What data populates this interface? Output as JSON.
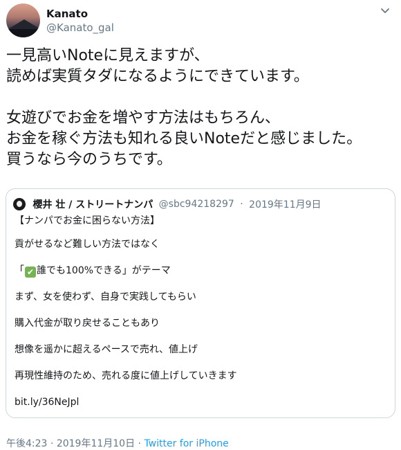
{
  "author": {
    "name": "Kanato",
    "handle": "@Kanato_gal"
  },
  "tweet": {
    "paragraphs": [
      [
        "一見高いNoteに見えますが、",
        "読めば実質タダになるようにできています。"
      ],
      [
        "女遊びでお金を増やす方法はもちろん、",
        "お金を稼ぐ方法も知れる良いNoteだと感じました。",
        "買うなら今のうちです。"
      ]
    ]
  },
  "quoted_tweet": {
    "author_name": "櫻井 壮 / ストリートナンパ",
    "author_handle": "@sbc94218297",
    "separator": "·",
    "date": "2019年11月9日",
    "lines": [
      "【ナンパでお金に困らない方法】",
      "貢がせるなど難しい方法ではなく",
      "「✅誰でも100%できる」がテーマ",
      "まず、女を使わず、自身で実践してもらい",
      "購入代金が取り戻せることもあり",
      "想像を遥かに超えるペースで売れ、値上げ",
      "再現性維持のため、売れる度に値上げしていきます",
      "bit.ly/36NeJpl"
    ],
    "line3_parts": {
      "before": "「",
      "emoji": "✔",
      "after": "誰でも100%できる」がテーマ"
    }
  },
  "footer": {
    "time": "午後4:23",
    "separator": "·",
    "date": "2019年11月10日",
    "separator2": "·",
    "source": "Twitter for iPhone"
  },
  "icons": {
    "caret": "chevron-down-icon",
    "emoji_check": "check-mark-emoji"
  },
  "colors": {
    "text_primary": "#14171a",
    "text_secondary": "#657786",
    "link": "#1da1f2",
    "border": "#ccd6dd",
    "check_emoji_bg": "#77b255"
  }
}
